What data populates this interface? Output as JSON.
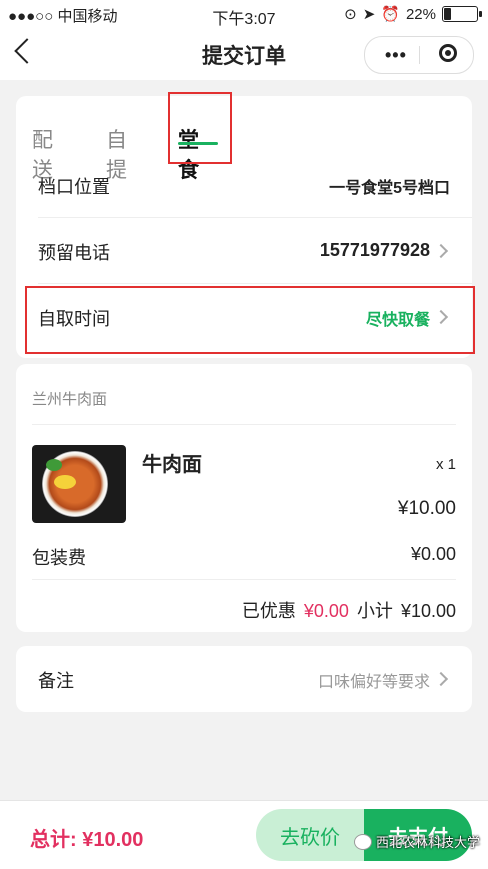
{
  "status_bar": {
    "carrier": "●●●○○ 中国移动",
    "time": "下午3:07",
    "battery": "22%",
    "battery_level": 0.22
  },
  "nav": {
    "title": "提交订单"
  },
  "tabs": [
    {
      "label": "配送"
    },
    {
      "label": "自提"
    },
    {
      "label": "堂食"
    }
  ],
  "delivery": {
    "stall_label": "档口位置",
    "stall_value": "一号食堂5号档口",
    "phone_label": "预留电话",
    "phone_value": "15771977928",
    "time_label": "自取时间",
    "time_value": "尽快取餐"
  },
  "order": {
    "shop": "兰州牛肉面",
    "item_name": "牛肉面",
    "item_qty": "x 1",
    "item_price": "¥10.00",
    "packing_label": "包装费",
    "packing_value": "¥0.00",
    "discount_label": "已优惠",
    "discount_value": "¥0.00",
    "subtotal_label": "小计",
    "subtotal_value": "¥10.00"
  },
  "remark": {
    "label": "备注",
    "placeholder": "口味偏好等要求"
  },
  "footer": {
    "total_label": "总计:",
    "total_value": "¥10.00",
    "bargain_button": "去砍价",
    "pay_button": "去支付"
  },
  "watermark": "西北农林科技大学",
  "colors": {
    "accent_green": "#19b15f",
    "price_red": "#e23060",
    "highlight_box": "#e23030"
  }
}
